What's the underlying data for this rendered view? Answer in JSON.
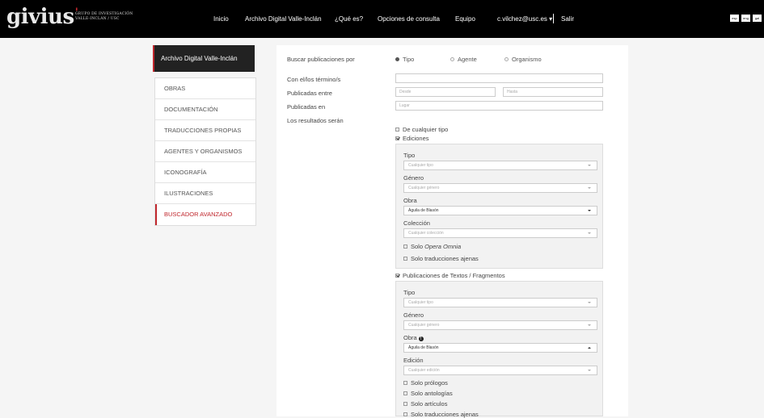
{
  "header": {
    "logo_text": "givius",
    "logo_sub_line1": "GRUPO DE INVESTIGACIÓN",
    "logo_sub_line2": "VALLE-INCLÁN / USC",
    "nav": [
      "Inicio",
      "Archivo Digital Valle-Inclán",
      "¿Qué es?",
      "Opciones de consulta",
      "Equipo"
    ],
    "user": "c.vilchez@usc.es ▾",
    "logout": "Salir",
    "languages": [
      "esp",
      "eng",
      "gal"
    ]
  },
  "sidebar": {
    "title": "Archivo Digital Valle-Inclán",
    "items": [
      "OBRAS",
      "DOCUMENTACIÓN",
      "TRADUCCIONES PROPIAS",
      "AGENTES Y ORGANISMOS",
      "ICONOGRAFÍA",
      "ILUSTRACIONES",
      "BUSCADOR AVANZADO"
    ],
    "active_index": 6
  },
  "search": {
    "label_search_by": "Buscar publicaciones por",
    "options": [
      "Tipo",
      "Agente",
      "Organismo"
    ],
    "selected_option": "Tipo",
    "label_terms": "Con el/los término/s",
    "terms_value": "",
    "label_published_between": "Publicadas entre",
    "from_placeholder": "Desde",
    "to_placeholder": "Hasta",
    "label_published_in": "Publicadas en",
    "place_placeholder": "Lugar",
    "label_results": "Los resultados serán"
  },
  "results": {
    "any_type": "De cualquier tipo",
    "editions": "Ediciones",
    "editions_panel": {
      "tipo_label": "Tipo",
      "tipo_value": "Cualquier tipo",
      "genero_label": "Género",
      "genero_value": "Cualquier género",
      "obra_label": "Obra",
      "obra_value": "Águila de Blasón",
      "coleccion_label": "Colección",
      "coleccion_value": "Cualquier colección",
      "solo_prefix": "Solo",
      "solo_italic": "Opera Omnia",
      "solo_trad": "Solo traducciones ajenas"
    },
    "texts": "Publicaciones de Textos / Fragmentos",
    "texts_panel": {
      "tipo_label": "Tipo",
      "tipo_value": "Cualquier tipo",
      "genero_label": "Género",
      "genero_value": "Cualquier género",
      "obra_label": "Obra",
      "obra_value": "Águila de Blasón",
      "edicion_label": "Edición",
      "edicion_value": "Cualquier edición",
      "checks": [
        "Solo prólogos",
        "Solo antologías",
        "Solo artículos",
        "Solo traducciones ajenas"
      ]
    }
  }
}
